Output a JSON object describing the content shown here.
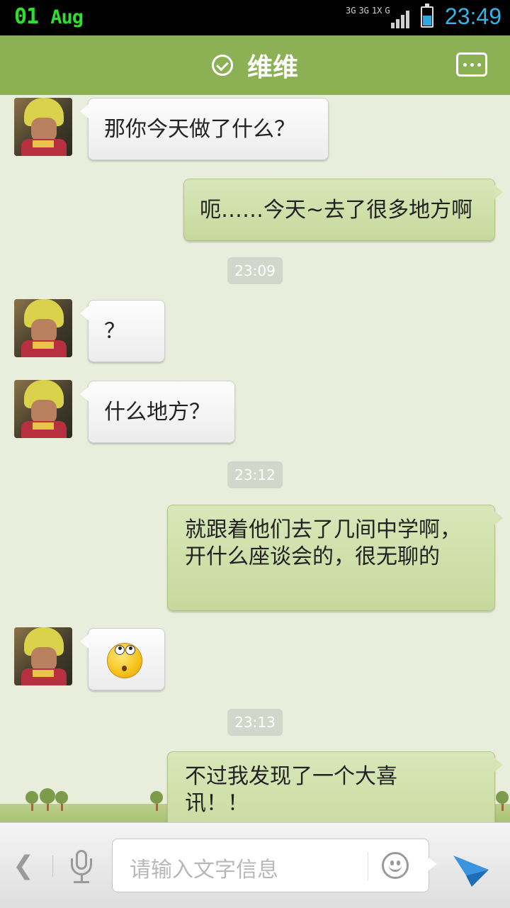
{
  "status_bar": {
    "day": "01",
    "month": "Aug",
    "net_types": [
      "3G",
      "3G",
      "1X",
      "G"
    ],
    "time": "23:49",
    "battery_color": "#2fa6e4",
    "time_color": "#33b5e5"
  },
  "header": {
    "title": "维维",
    "verified_icon": "check-circle-icon",
    "menu_icon": "chat-bubble-more-icon"
  },
  "messages": [
    {
      "side": "left",
      "text": "那你今天做了什么？"
    },
    {
      "side": "right",
      "text": "呃……今天~去了很多地方啊"
    },
    {
      "type": "time",
      "text": "23:09"
    },
    {
      "side": "left",
      "text": "？"
    },
    {
      "side": "left",
      "text": "什么地方？"
    },
    {
      "type": "time",
      "text": "23:12"
    },
    {
      "side": "right",
      "text": "就跟着他们去了几间中学啊，开什么座谈会的，很无聊的"
    },
    {
      "side": "left",
      "emoji": "rolling-eyes-emoji"
    },
    {
      "type": "time",
      "text": "23:13"
    },
    {
      "side": "right",
      "text": "不过我发现了一个大喜讯！！"
    }
  ],
  "input_bar": {
    "placeholder": "请输入文字信息",
    "back_icon": "chevron-left-icon",
    "voice_icon": "microphone-icon",
    "emoji_icon": "smiley-icon",
    "send_icon": "paper-plane-icon"
  },
  "colors": {
    "header": "#8cb054",
    "chat_bg": "#e9eedc",
    "outgoing_bubble": "#cfe0a8",
    "incoming_bubble": "#f4f4f4",
    "send_icon": "#2a86d4"
  }
}
